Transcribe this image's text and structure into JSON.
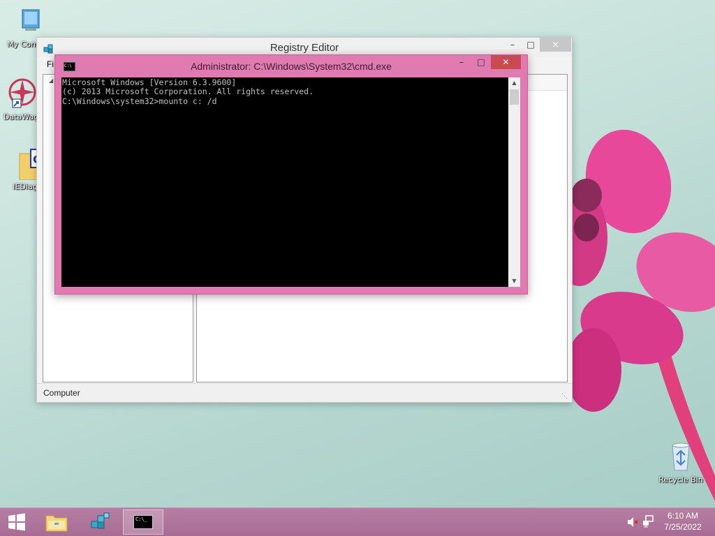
{
  "desktop": {
    "icons": [
      {
        "label": "My Comp",
        "icon": "my-computer-icon"
      },
      {
        "label": "DataWag",
        "icon": "datawagon-icon"
      },
      {
        "label": "IEDiag",
        "icon": "folder-icon"
      },
      {
        "label": "Recycle Bin",
        "icon": "recycle-bin-icon"
      }
    ]
  },
  "regedit": {
    "title": "Registry Editor",
    "menu_first": "Fi",
    "status": "Computer",
    "buttons": {
      "minimize": "–",
      "maximize": "□",
      "close": "✕"
    }
  },
  "cmd": {
    "title": "Administrator: C:\\Windows\\System32\\cmd.exe",
    "icon_text": "C:\\",
    "lines": [
      "Microsoft Windows [Version 6.3.9600]",
      "(c) 2013 Microsoft Corporation. All rights reserved.",
      "",
      "C:\\Windows\\system32>mounto c: /d"
    ],
    "buttons": {
      "minimize": "–",
      "maximize": "□",
      "close": "✕"
    }
  },
  "taskbar": {
    "items": [
      {
        "name": "start-button",
        "icon": "windows-logo-icon"
      },
      {
        "name": "file-explorer",
        "icon": "file-explorer-icon"
      },
      {
        "name": "registry-editor",
        "icon": "registry-editor-icon"
      },
      {
        "name": "command-prompt",
        "icon": "command-prompt-icon",
        "active": true
      }
    ],
    "cmd_icon_text": "C:\\_",
    "tray": {
      "time": "6:10 AM",
      "date": "7/25/2022",
      "icons": [
        "volume-muted-icon",
        "network-icon"
      ]
    }
  },
  "colors": {
    "taskbar": "#a86c94",
    "cmd_frame": "#e07ab0",
    "close_button": "#c94a52",
    "console_bg": "#000000",
    "console_text": "#c0c0c0"
  }
}
